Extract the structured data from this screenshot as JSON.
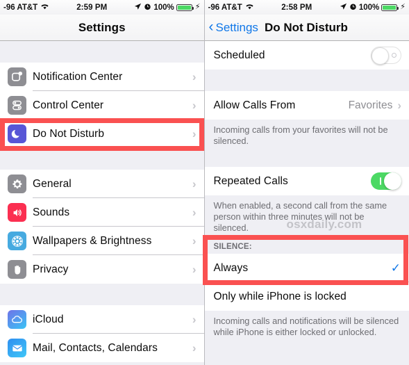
{
  "left_panel": {
    "status_bar": {
      "carrier": "-96 AT&T",
      "wifi_icon": "wifi-icon",
      "time": "2:59 PM",
      "location_icon": "location-arrow-icon",
      "alarm_icon": "alarm-clock-icon",
      "battery_percent": "100%",
      "battery_icon": "battery-icon",
      "charging_icon": "lightning-bolt-icon"
    },
    "nav": {
      "title": "Settings"
    },
    "groups": [
      {
        "items": [
          {
            "label": "Notification Center",
            "icon": "notification-center-icon",
            "icon_color": "#8e8e93",
            "accessory": "chevron-right-icon"
          },
          {
            "label": "Control Center",
            "icon": "control-center-icon",
            "icon_color": "#8e8e93",
            "accessory": "chevron-right-icon"
          },
          {
            "label": "Do Not Disturb",
            "icon": "do-not-disturb-moon-icon",
            "icon_color": "#5856d6",
            "accessory": "chevron-right-icon"
          }
        ]
      },
      {
        "items": [
          {
            "label": "General",
            "icon": "gear-icon",
            "icon_color": "#8e8e93",
            "accessory": "chevron-right-icon"
          },
          {
            "label": "Sounds",
            "icon": "speaker-icon",
            "icon_color": "#fb2f51",
            "accessory": "chevron-right-icon"
          },
          {
            "label": "Wallpapers & Brightness",
            "icon": "flower-icon",
            "icon_color": "#46aae0",
            "accessory": "chevron-right-icon"
          },
          {
            "label": "Privacy",
            "icon": "hand-icon",
            "icon_color": "#8e8e93",
            "accessory": "chevron-right-icon"
          }
        ]
      },
      {
        "items": [
          {
            "label": "iCloud",
            "icon": "cloud-icon",
            "icon_color": "#3ab4f2",
            "accessory": "chevron-right-icon"
          },
          {
            "label": "Mail, Contacts, Calendars",
            "icon": "envelope-icon",
            "icon_color": "#32a8f0",
            "accessory": "chevron-right-icon"
          }
        ]
      }
    ]
  },
  "right_panel": {
    "status_bar": {
      "carrier": "-96 AT&T",
      "wifi_icon": "wifi-icon",
      "time": "2:58 PM",
      "location_icon": "location-arrow-icon",
      "alarm_icon": "alarm-clock-icon",
      "battery_percent": "100%",
      "battery_icon": "battery-icon",
      "charging_icon": "lightning-bolt-icon"
    },
    "nav": {
      "back_label": "Settings",
      "back_icon": "chevron-left-icon",
      "title": "Do Not Disturb"
    },
    "scheduled": {
      "label": "Scheduled",
      "toggle_state": "off"
    },
    "allow_calls": {
      "label": "Allow Calls From",
      "value": "Favorites",
      "accessory": "chevron-right-icon",
      "description": "Incoming calls from your favorites will not be silenced."
    },
    "repeated_calls": {
      "label": "Repeated Calls",
      "toggle_state": "on",
      "description": "When enabled, a second call from the same person within three minutes will not be silenced."
    },
    "watermark": "osxdaily.com",
    "silence": {
      "section_header": "SILENCE:",
      "options": [
        {
          "label": "Always",
          "selected": true,
          "accessory": "checkmark-icon"
        },
        {
          "label": "Only while iPhone is locked",
          "selected": false,
          "accessory": ""
        }
      ],
      "description": "Incoming calls and notifications will be silenced while iPhone is either locked or unlocked."
    }
  },
  "annotations": {
    "highlight_color": "#fa5151",
    "boxes": [
      {
        "name": "do-not-disturb-row-highlight"
      },
      {
        "name": "silence-always-highlight"
      }
    ]
  }
}
